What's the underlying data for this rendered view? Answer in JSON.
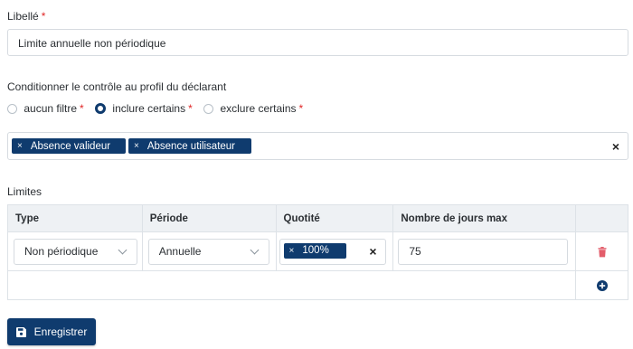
{
  "label_field": {
    "label": "Libellé",
    "required_mark": "*",
    "value": "Limite annuelle non périodique"
  },
  "profile": {
    "title": "Conditionner le contrôle au profil du déclarant",
    "options": [
      {
        "label": "aucun filtre",
        "selected": false
      },
      {
        "label": "inclure certains",
        "selected": true
      },
      {
        "label": "exclure certains",
        "selected": false
      }
    ],
    "required_mark": "*",
    "tags": [
      "Absence valideur",
      "Absence utilisateur"
    ],
    "tag_remove_glyph": "×",
    "clear_glyph": "×"
  },
  "limits": {
    "title": "Limites",
    "columns": [
      "Type",
      "Période",
      "Quotité",
      "Nombre de jours max"
    ],
    "row": {
      "type": "Non périodique",
      "period": "Annuelle",
      "quotite_tag": "100%",
      "days_max": "75"
    }
  },
  "save_button": {
    "label": "Enregistrer"
  },
  "colors": {
    "primary": "#0f3b6e",
    "danger": "#e35d6a",
    "required": "#e02424"
  },
  "icons": {
    "delete": "trash-icon",
    "add": "plus-circle-icon",
    "save": "floppy-disk-icon",
    "remove_tag": "close-icon",
    "clear": "close-icon",
    "dropdown": "chevron-down-icon"
  }
}
